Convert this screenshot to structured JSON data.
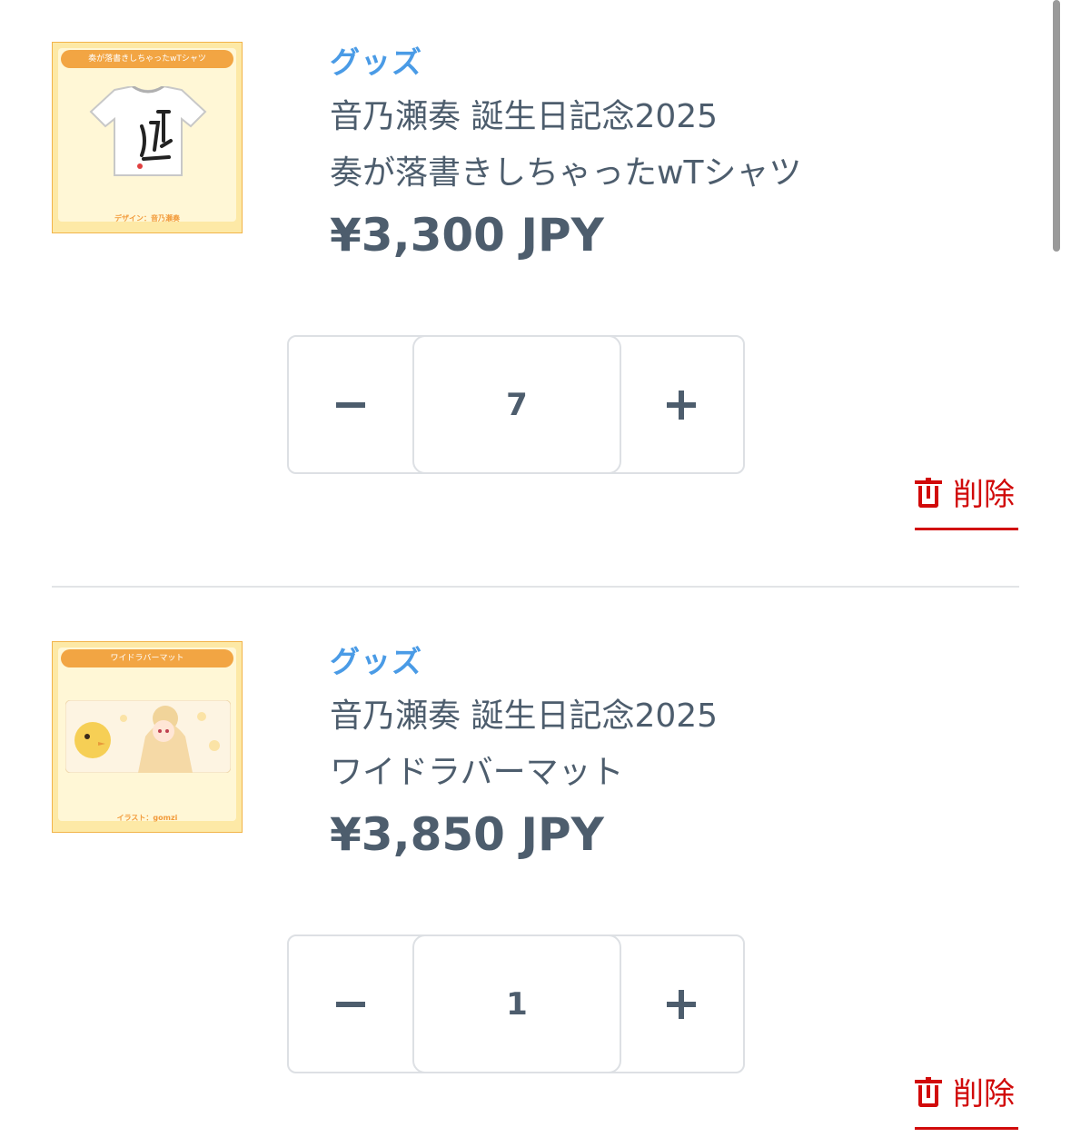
{
  "items": [
    {
      "thumbnail": {
        "banner": "奏が落書きしちゃったwTシャツ",
        "caption": "デザイン：音乃瀬奏"
      },
      "category": "グッズ",
      "title_line1": "音乃瀬奏 誕生日記念2025",
      "title_line2": "奏が落書きしちゃったwTシャツ",
      "price": "¥3,300 JPY",
      "quantity": "7",
      "delete_label": "削除"
    },
    {
      "thumbnail": {
        "banner": "ワイドラバーマット",
        "caption": "イラスト：gomzi"
      },
      "category": "グッズ",
      "title_line1": "音乃瀬奏 誕生日記念2025",
      "title_line2": "ワイドラバーマット",
      "price": "¥3,850 JPY",
      "quantity": "1",
      "delete_label": "削除"
    }
  ],
  "colors": {
    "category": "#4a9be6",
    "text": "#4d5d6d",
    "delete": "#d10a0a",
    "border": "#dde0e4"
  }
}
